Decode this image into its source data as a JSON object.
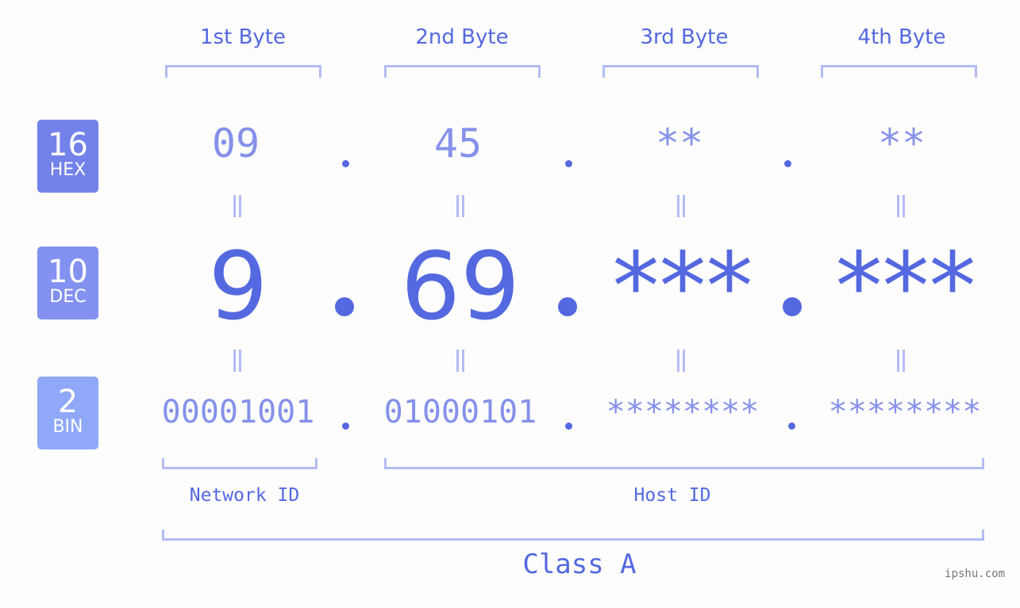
{
  "byte_headers": [
    "1st Byte",
    "2nd Byte",
    "3rd Byte",
    "4th Byte"
  ],
  "badges": {
    "hex": {
      "num": "16",
      "label": "HEX",
      "color": "#7381ea"
    },
    "dec": {
      "num": "10",
      "label": "DEC",
      "color": "#8391f0"
    },
    "bin": {
      "num": "2",
      "label": "BIN",
      "color": "#8fa8f8"
    }
  },
  "hex_values": [
    "09",
    "45",
    "**",
    "**"
  ],
  "dec_values": [
    "9",
    "69",
    "***",
    "***"
  ],
  "bin_values": [
    "00001001",
    "01000101",
    "********",
    "********"
  ],
  "labels": {
    "network_id": "Network ID",
    "host_id": "Host ID",
    "class": "Class A"
  },
  "watermark": "ipshu.com",
  "colors": {
    "accent": "#5468e0",
    "light": "#8591ea",
    "bracket": "#b3bcf5"
  }
}
